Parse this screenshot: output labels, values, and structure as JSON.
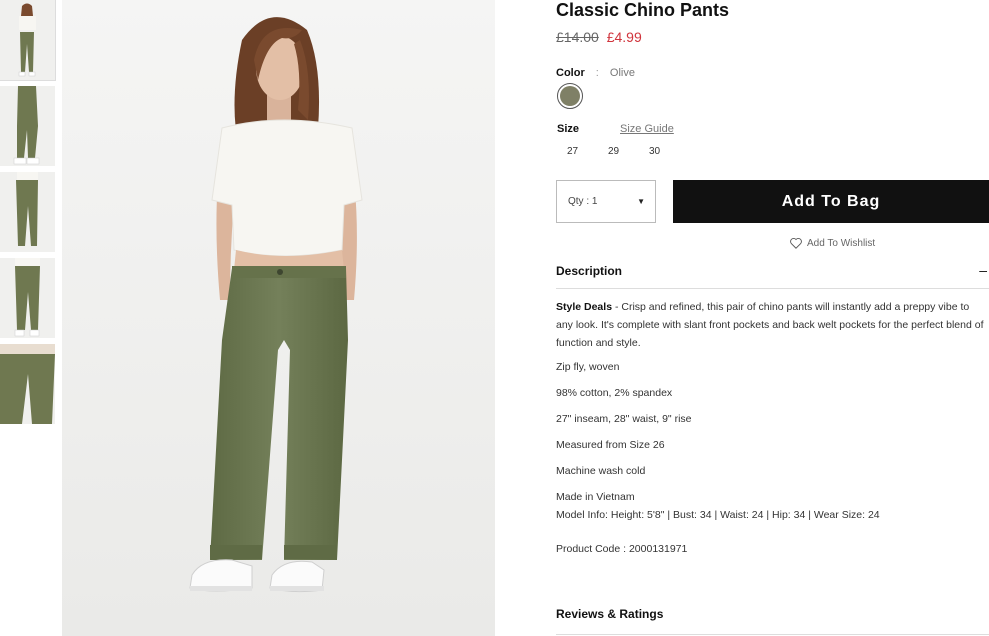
{
  "product": {
    "title": "Classic Chino Pants",
    "old_price": "£14.00",
    "new_price": "£4.99"
  },
  "color": {
    "label": "Color",
    "separator": ":",
    "value": "Olive",
    "swatch_color": "#7f8066"
  },
  "size": {
    "label": "Size",
    "guide_label": "Size Guide",
    "options": [
      "27",
      "29",
      "30"
    ]
  },
  "quantity": {
    "label": "Qty : 1"
  },
  "actions": {
    "add_to_bag": "Add To Bag",
    "wishlist": "Add To Wishlist"
  },
  "description": {
    "header": "Description",
    "toggle": "–",
    "lead_bold": "Style Deals",
    "lead_text": " - Crisp and refined, this pair of chino pants will instantly add a preppy vibe to any look. It's complete with slant front pockets and back welt pockets for the perfect blend of function and style.",
    "bullets": [
      "Zip fly, woven",
      "98% cotton, 2% spandex",
      "27\" inseam, 28\" waist, 9\" rise",
      "Measured from Size 26",
      "Machine wash cold",
      "Made in Vietnam"
    ],
    "model_info": "Model Info: Height: 5'8\" | Bust: 34 | Waist: 24 | Hip: 34 | Wear Size: 24",
    "product_code": "Product Code : 2000131971"
  },
  "reviews": {
    "header": "Reviews & Ratings"
  },
  "colors": {
    "accent_red": "#d0343c",
    "button_black": "#111111",
    "pant_olive": "#6f7850",
    "top_white": "#f7f6f2"
  },
  "thumbnails": [
    {
      "name": "full-front"
    },
    {
      "name": "side"
    },
    {
      "name": "back"
    },
    {
      "name": "front-close"
    },
    {
      "name": "detail"
    }
  ]
}
